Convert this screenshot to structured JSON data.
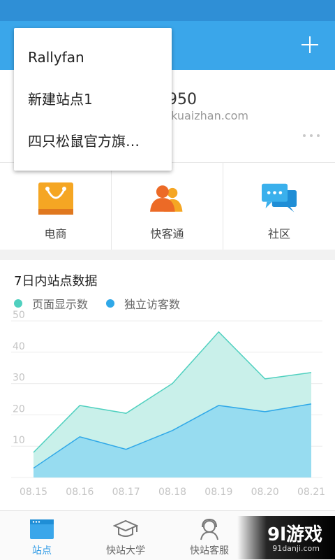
{
  "site": {
    "id_fragment": "950",
    "domain_fragment": ".kuaizhan.com"
  },
  "dropdown": {
    "items": [
      "Rallyfan",
      "新建站点1",
      "四只松鼠官方旗…"
    ]
  },
  "features": [
    {
      "label": "电商",
      "icon": "shopping-bag-icon"
    },
    {
      "label": "快客通",
      "icon": "users-icon"
    },
    {
      "label": "社区",
      "icon": "chat-bubbles-icon"
    }
  ],
  "chart": {
    "title": "7日内站点数据"
  },
  "chart_data": {
    "type": "area",
    "title": "7日内站点数据",
    "categories": [
      "08.15",
      "08.16",
      "08.17",
      "08.18",
      "08.19",
      "08.20",
      "08.21"
    ],
    "series": [
      {
        "name": "页面显示数",
        "color": "#4fd0bf",
        "values": [
          8,
          23,
          20.5,
          30,
          46.5,
          31.5,
          33.5
        ]
      },
      {
        "name": "独立访客数",
        "color": "#2fa8e8",
        "values": [
          3,
          13,
          9,
          15,
          23,
          21,
          23.5
        ]
      }
    ],
    "yticks": [
      10,
      20,
      30,
      40,
      50
    ],
    "ylim": [
      0,
      50
    ],
    "grid": true,
    "legend": "top-left"
  },
  "tabs": [
    {
      "label": "站点",
      "icon": "site-window-icon",
      "active": true
    },
    {
      "label": "快站大学",
      "icon": "graduation-cap-icon",
      "active": false
    },
    {
      "label": "快站客服",
      "icon": "support-headset-icon",
      "active": false
    }
  ],
  "watermark": {
    "logo": "9l游戏",
    "url": "91danji.com"
  },
  "colors": {
    "appbar": "#3aa6ea",
    "statusbar": "#2f8fd6",
    "accent": "#2f9be6"
  }
}
